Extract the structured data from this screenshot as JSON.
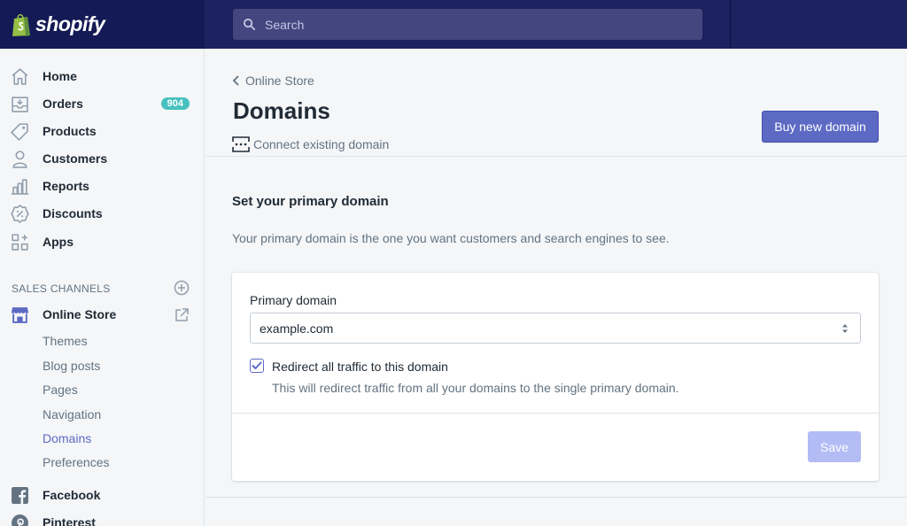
{
  "app": {
    "brand": "shopify"
  },
  "search": {
    "placeholder": "Search"
  },
  "sidebar": {
    "items": [
      {
        "label": "Home",
        "icon": "home-icon"
      },
      {
        "label": "Orders",
        "icon": "orders-icon",
        "badge": "904"
      },
      {
        "label": "Products",
        "icon": "tag-icon"
      },
      {
        "label": "Customers",
        "icon": "person-icon"
      },
      {
        "label": "Reports",
        "icon": "bar-chart-icon"
      },
      {
        "label": "Discounts",
        "icon": "discount-icon"
      },
      {
        "label": "Apps",
        "icon": "apps-icon"
      }
    ],
    "sales_channels_heading": "SALES CHANNELS",
    "online_store": {
      "label": "Online Store",
      "icon": "store-icon"
    },
    "online_store_sub": [
      "Themes",
      "Blog posts",
      "Pages",
      "Navigation",
      "Domains",
      "Preferences"
    ],
    "active_sub": "Domains",
    "other_channels": [
      {
        "label": "Facebook",
        "icon": "facebook-icon"
      },
      {
        "label": "Pinterest",
        "icon": "pinterest-icon"
      }
    ]
  },
  "page": {
    "breadcrumb": "Online Store",
    "title": "Domains",
    "connect_link": "Connect existing domain",
    "buy_button": "Buy new domain"
  },
  "section": {
    "title": "Set your primary domain",
    "description": "Your primary domain is the one you want customers and search engines to see."
  },
  "form": {
    "field_label": "Primary domain",
    "selected_value": "example.com",
    "checkbox_label": "Redirect all traffic to this domain",
    "checkbox_checked": true,
    "checkbox_help": "This will redirect traffic from all your domains to the single primary domain.",
    "save_button": "Save"
  },
  "colors": {
    "topbar": "#1c2260",
    "accent": "#5c6ac4",
    "badge": "#47c1bf",
    "save_disabled": "#b3bcf5"
  }
}
